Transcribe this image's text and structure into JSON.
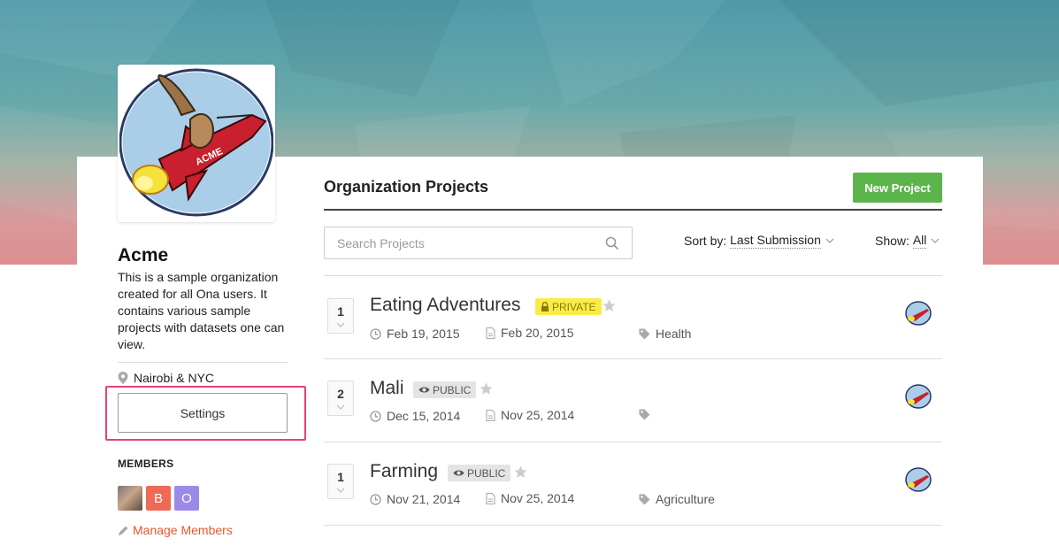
{
  "org": {
    "name": "Acme",
    "description": "This is a sample organization created for all Ona users. It contains various sample projects with datasets one can view.",
    "location": "Nairobi & NYC",
    "settings_label": "Settings",
    "members_heading": "MEMBERS",
    "members": [
      {
        "initial": "",
        "kind": "photo"
      },
      {
        "initial": "B",
        "color": "#ef6a56"
      },
      {
        "initial": "O",
        "color": "#9b8ae6"
      }
    ],
    "manage_members_label": "Manage Members"
  },
  "projects_panel": {
    "title": "Organization Projects",
    "new_project_label": "New Project",
    "search_placeholder": "Search Projects",
    "sort_label": "Sort by:",
    "sort_value": "Last Submission",
    "show_label": "Show:",
    "show_value": "All"
  },
  "projects": [
    {
      "votes": "1",
      "name": "Eating Adventures",
      "visibility": "PRIVATE",
      "created": "Feb 19, 2015",
      "updated": "Feb 20, 2015",
      "tag": "Health"
    },
    {
      "votes": "2",
      "name": "Mali",
      "visibility": "PUBLIC",
      "created": "Dec 15, 2014",
      "updated": "Nov 25, 2014",
      "tag": ""
    },
    {
      "votes": "1",
      "name": "Farming",
      "visibility": "PUBLIC",
      "created": "Nov 21, 2014",
      "updated": "Nov 25, 2014",
      "tag": "Agriculture"
    }
  ],
  "colors": {
    "accent_link": "#e8572a",
    "new_project_button": "#5cb54a",
    "settings_highlight": "#e8407a",
    "private_badge": "#f9ec4a",
    "public_badge": "#e4e4e4"
  },
  "icons": [
    "search-icon",
    "map-pin-icon",
    "pencil-icon",
    "clock-icon",
    "file-icon",
    "tag-icon",
    "star-icon",
    "lock-icon",
    "eye-icon",
    "chevron-down-icon"
  ]
}
